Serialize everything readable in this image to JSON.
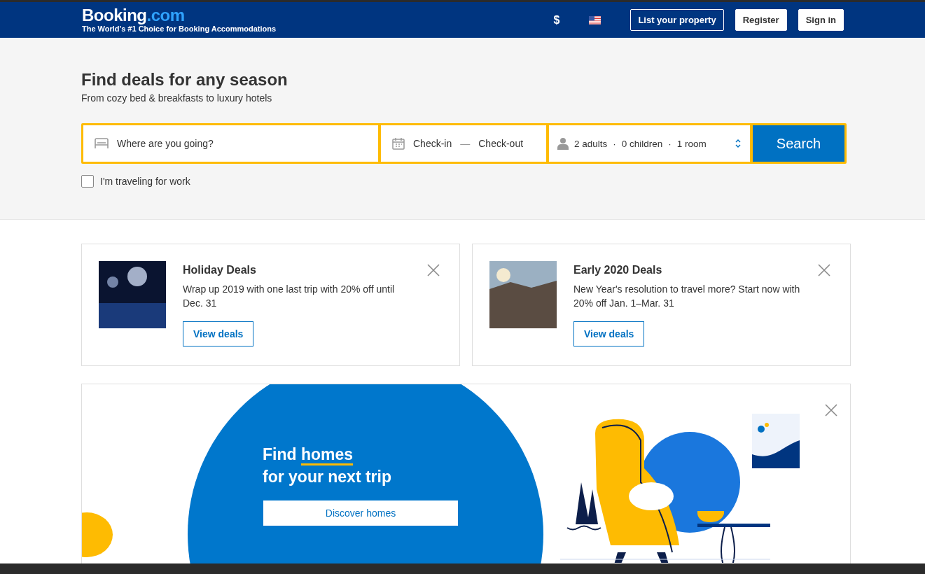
{
  "header": {
    "logo_main": "Booking",
    "logo_suffix": ".com",
    "tagline": "The World's #1 Choice for Booking Accommodations",
    "currency": "$",
    "buttons": [
      {
        "label": "List your property",
        "kind": "outline"
      },
      {
        "label": "Register",
        "kind": "solid"
      },
      {
        "label": "Sign in",
        "kind": "solid"
      }
    ]
  },
  "hero": {
    "title": "Find deals for any season",
    "subtitle": "From cozy bed & breakfasts to luxury hotels",
    "destination": {
      "placeholder": "Where are you going?"
    },
    "dates": {
      "check_in": "Check-in",
      "separator": "—",
      "check_out": "Check-out"
    },
    "guests": {
      "adults": "2 adults",
      "children": "0 children",
      "rooms": "1 room",
      "separator": "·"
    },
    "search_button": "Search",
    "work_travel": {
      "label": "I'm traveling for work",
      "checked": false
    }
  },
  "deals": [
    {
      "title": "Holiday Deals",
      "text": "Wrap up 2019 with one last trip with 20% off until Dec. 31",
      "button": "View deals",
      "kind": "fireworks"
    },
    {
      "title": "Early 2020 Deals",
      "text": "New Year's resolution to travel more? Start now with 20% off Jan. 1–Mar. 31",
      "button": "View deals",
      "kind": "mountain"
    }
  ],
  "banner": {
    "find": "Find",
    "link": "homes",
    "line2": "for your next trip",
    "button": "Discover homes"
  }
}
